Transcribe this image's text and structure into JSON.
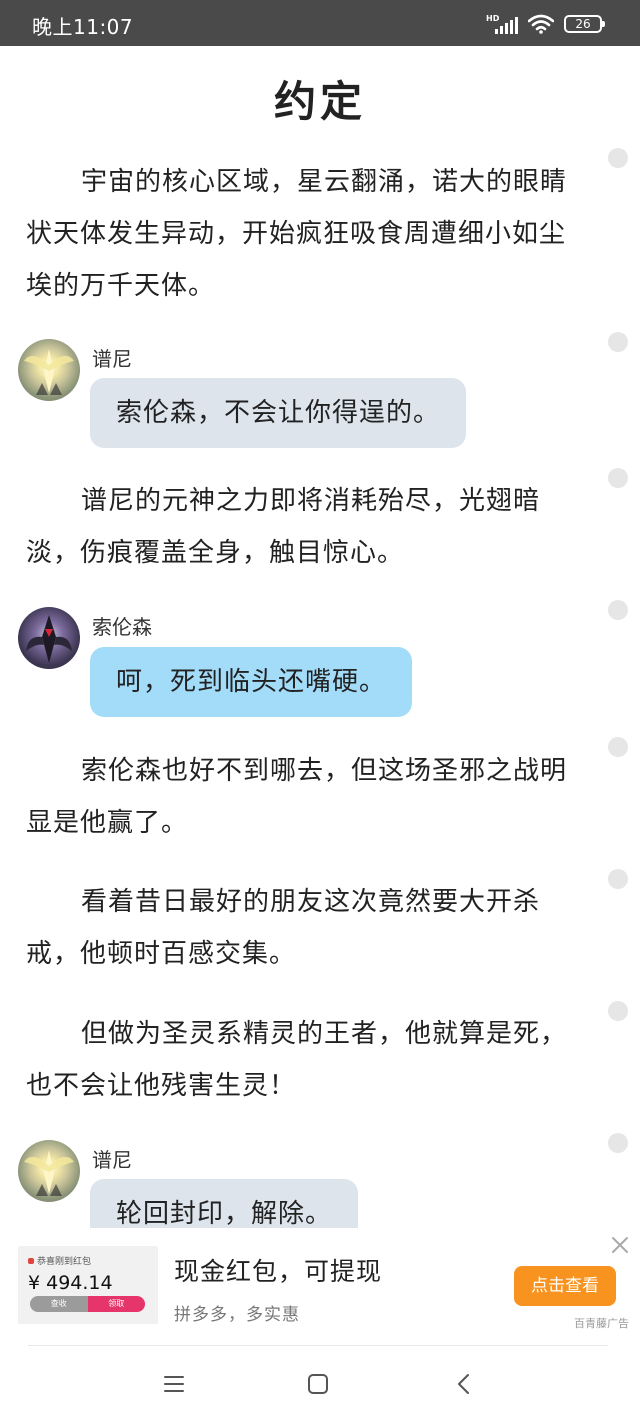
{
  "status_bar": {
    "time": "晚上11:07",
    "network_label": "HD",
    "battery_level": "26",
    "icons": [
      "hd-signal-icon",
      "wifi-icon",
      "battery-icon"
    ]
  },
  "article": {
    "title": "约定",
    "paragraphs": [
      "宇宙的核心区域，星云翻涌，诺大的眼睛状天体发生异动，开始疯狂吸食周遭细小如尘埃的万千天体。",
      "谱尼的元神之力即将消耗殆尽，光翅暗淡，伤痕覆盖全身，触目惊心。",
      "索伦森也好不到哪去，但这场圣邪之战明显是他赢了。",
      "看着昔日最好的朋友这次竟然要大开杀戒，他顿时百感交集。",
      "但做为圣灵系精灵的王者，他就算是死，也不会让他残害生灵！"
    ],
    "dialogues": [
      {
        "speaker": "谱尼",
        "text": "索伦森，不会让你得逞的。"
      },
      {
        "speaker": "索伦森",
        "text": "呵，死到临头还嘴硬。"
      },
      {
        "speaker": "谱尼",
        "text": "轮回封印，解除。"
      }
    ]
  },
  "ad": {
    "thumb_title": "恭喜刚到红包",
    "thumb_amount": "¥ 494.14",
    "thumb_check": "查收",
    "thumb_get": "领取",
    "title": "现金红包，可提现",
    "subtitle": "拼多多，多实惠",
    "button": "点击查看",
    "source": "百青藤广告",
    "button_color": "#f7931e"
  },
  "nav_bar": {
    "icons": [
      "menu-icon",
      "home-icon",
      "back-icon"
    ]
  },
  "colors": {
    "status_bar": "#4a4a4a",
    "bubble_puni": "#dde4ec",
    "bubble_suolunsen": "#a3dcf9"
  }
}
